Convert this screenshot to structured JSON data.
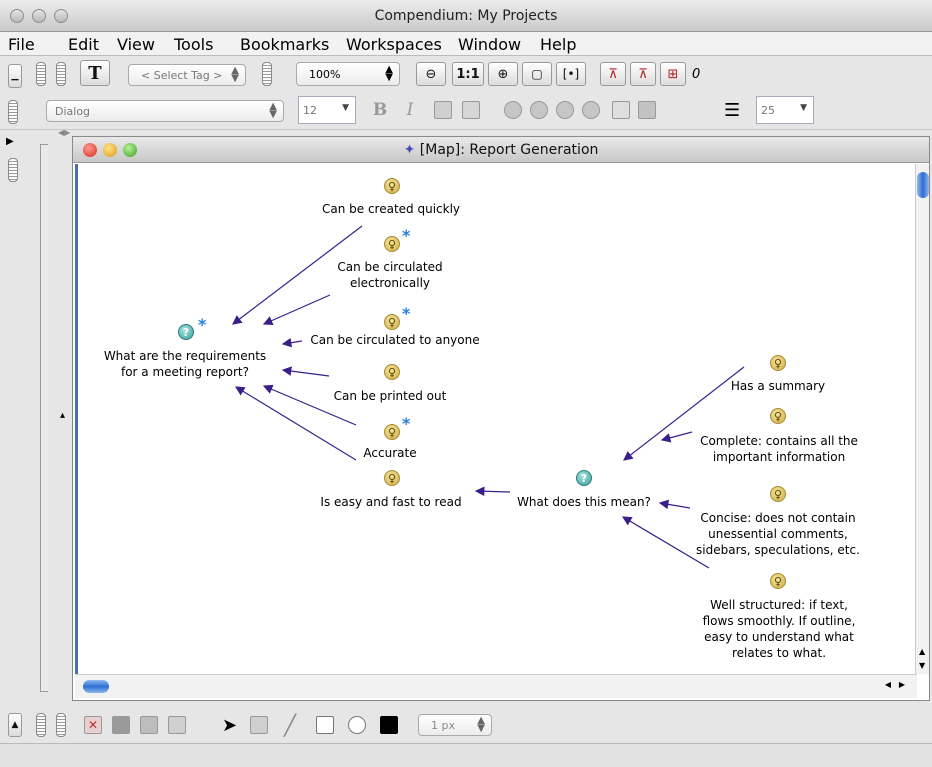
{
  "window": {
    "title": "Compendium: My Projects"
  },
  "menu": [
    "File",
    "Edit",
    "View",
    "Tools",
    "Bookmarks",
    "Workspaces",
    "Window",
    "Help"
  ],
  "toolbar": {
    "bold_t": "T",
    "select_tag": "< Select Tag >",
    "zoom": "100%",
    "one_to_one": "1:1",
    "slide_count": "0"
  },
  "format_bar": {
    "font": "Dialog",
    "size": "12",
    "bold": "B",
    "italic": "I",
    "spacing": "25"
  },
  "map": {
    "title": "[Map]: Report Generation",
    "nodes": [
      {
        "id": "created",
        "type": "idea",
        "label": "Can be created quickly",
        "star": false
      },
      {
        "id": "circulated",
        "type": "idea",
        "label": "Can be circulated\nelectronically",
        "star": true
      },
      {
        "id": "anyone",
        "type": "idea",
        "label": "Can be circulated to anyone",
        "star": true
      },
      {
        "id": "printed",
        "type": "idea",
        "label": "Can be printed out",
        "star": false
      },
      {
        "id": "accurate",
        "type": "idea",
        "label": "Accurate",
        "star": true
      },
      {
        "id": "easy",
        "type": "idea",
        "label": "Is easy and fast to read",
        "star": false
      },
      {
        "id": "requirements",
        "type": "question",
        "label": "What are the requirements\nfor a meeting report?",
        "star": true
      },
      {
        "id": "mean",
        "type": "question",
        "label": "What does this mean?",
        "star": false
      },
      {
        "id": "summary",
        "type": "idea",
        "label": "Has a summary",
        "star": false
      },
      {
        "id": "complete",
        "type": "idea",
        "label": "Complete: contains all the\nimportant information",
        "star": false
      },
      {
        "id": "concise",
        "type": "idea",
        "label": "Concise: does not contain\nunessential comments,\nsidebars, speculations, etc.",
        "star": false
      },
      {
        "id": "structured",
        "type": "idea",
        "label": "Well structured: if text,\nflows smoothly. If outline,\neasy to understand what\nrelates to what.",
        "star": false
      }
    ]
  },
  "drawbar": {
    "line_width": "1 px"
  },
  "colors": {
    "arrow": "#3a1f8a",
    "accent": "#2a7fd8"
  }
}
